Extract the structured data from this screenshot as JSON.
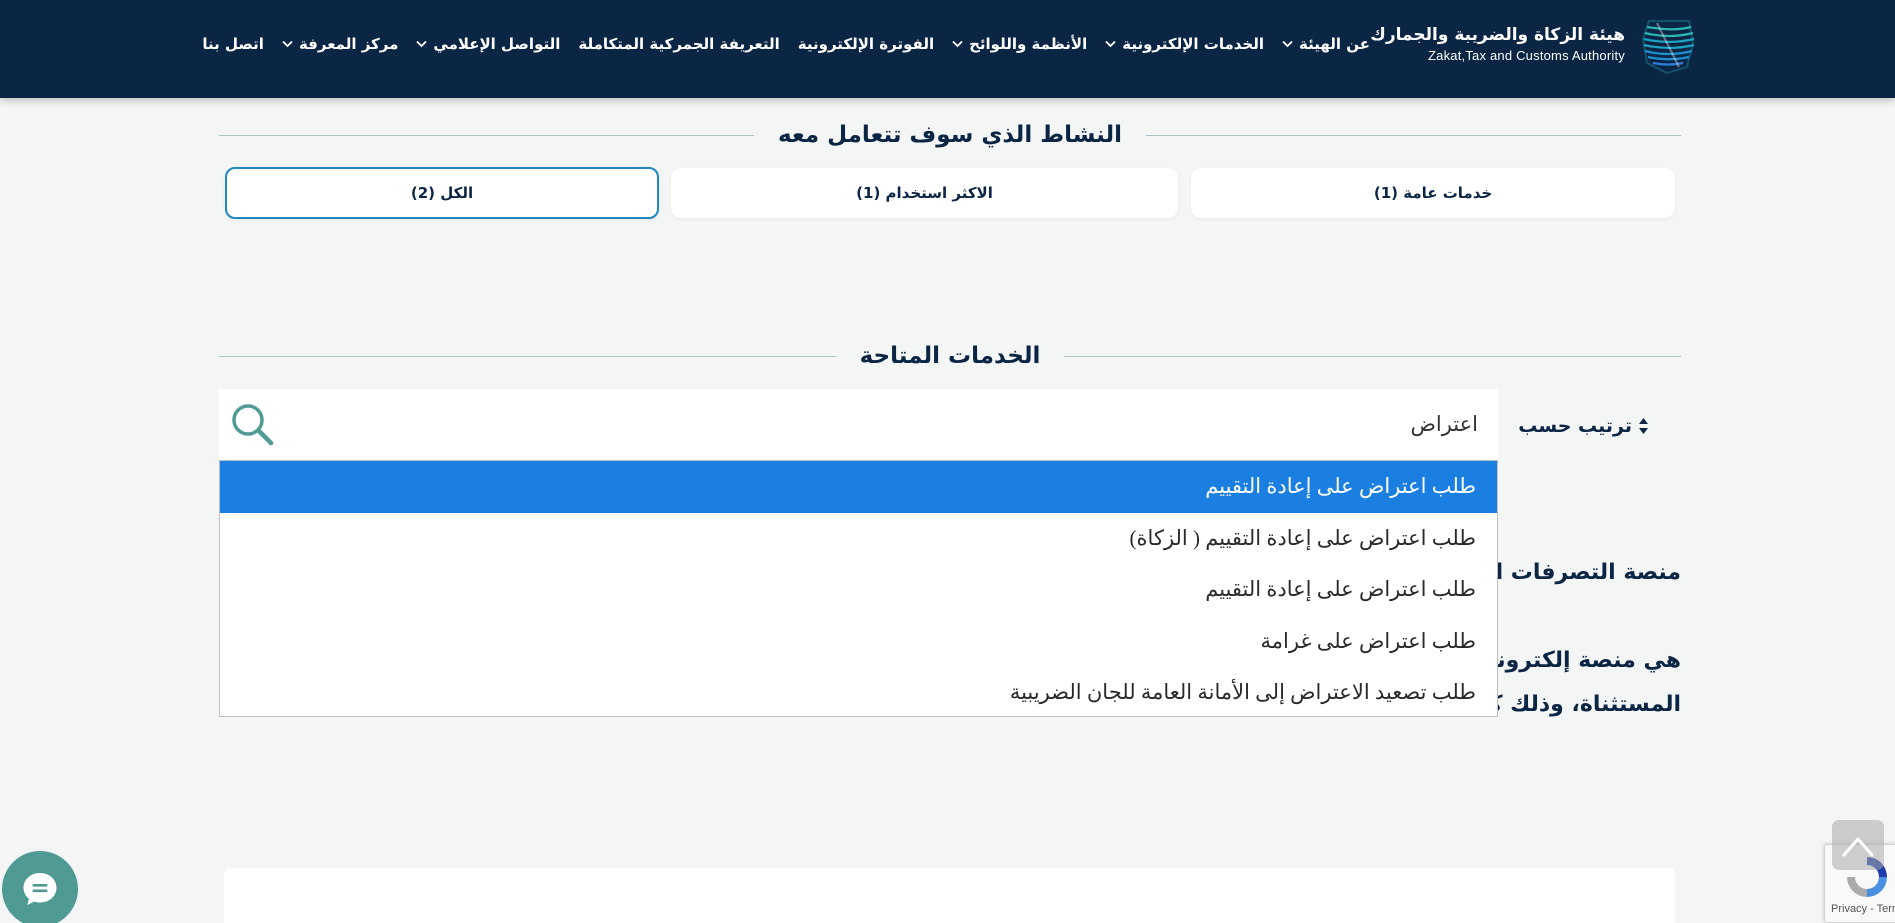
{
  "brand": {
    "name_ar": "هيئة الزكاة والضريبة والجمارك",
    "name_en": "Zakat,Tax and Customs Authority",
    "logo_icon": "zatca-logo-icon"
  },
  "nav": {
    "items": [
      {
        "label": "عن الهيئة",
        "has_dropdown": true
      },
      {
        "label": "الخدمات الإلكترونية",
        "has_dropdown": true
      },
      {
        "label": "الأنظمة واللوائح",
        "has_dropdown": true
      },
      {
        "label": "الفوترة الإلكترونية",
        "has_dropdown": false
      },
      {
        "label": "التعريفة الجمركية المتكاملة",
        "has_dropdown": false
      },
      {
        "label": "التواصل الإعلامي",
        "has_dropdown": true
      },
      {
        "label": "مركز المعرفة",
        "has_dropdown": true
      },
      {
        "label": "اتصل بنا",
        "has_dropdown": false
      }
    ]
  },
  "activity_section": {
    "title": "النشاط الذي سوف تتعامل معه",
    "tabs": [
      {
        "label": "خدمات عامة (1)",
        "active": false
      },
      {
        "label": "الاكثر استخدام (1)",
        "active": false
      },
      {
        "label": "الكل (2)",
        "active": true
      }
    ]
  },
  "services_section": {
    "title": "الخدمات المتاحة",
    "sort_label": "ترتيب حسب",
    "search": {
      "value": "اعتراض",
      "placeholder": ""
    },
    "suggestions": [
      {
        "label": "طلب اعتراض على إعادة التقييم",
        "highlighted": true
      },
      {
        "label": "طلب اعتراض على إعادة التقييم ( الزكاة)",
        "highlighted": false
      },
      {
        "label": "طلب اعتراض على إعادة التقييم",
        "highlighted": false
      },
      {
        "label": "طلب اعتراض على غرامة",
        "highlighted": false
      },
      {
        "label": "طلب تصعيد الاعتراض إلى الأمانة العامة للجان الضريبية",
        "highlighted": false
      }
    ],
    "background_content": {
      "line1": "منصة التصرفات العق",
      "line2": "هي منصة إلكترونية",
      "line3": "المستثناة، وذلك كم"
    }
  },
  "widgets": {
    "chat_icon": "chat-bubble-icon",
    "scroll_top_icon": "chevron-up-icon",
    "recaptcha_text": "Privacy - Term"
  },
  "colors": {
    "header_bg": "#0b2545",
    "accent_teal": "#4f9b94",
    "active_tab_border": "#1f89c0",
    "highlight": "#1a7fe0",
    "page_bg": "#f4f5f5"
  }
}
